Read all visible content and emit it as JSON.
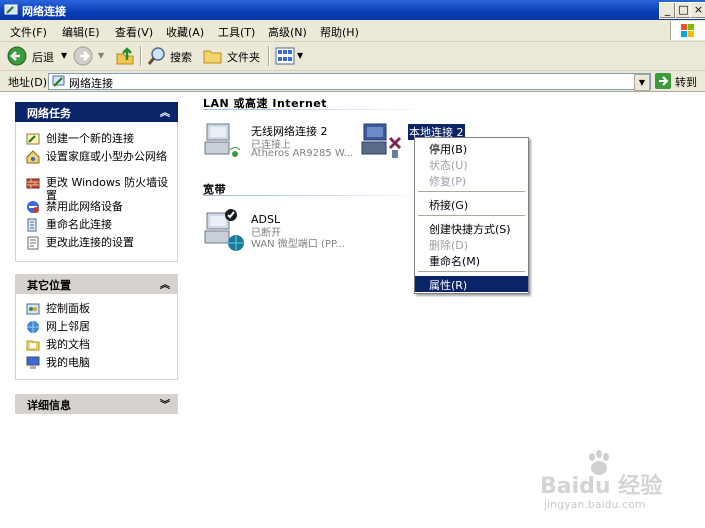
{
  "window": {
    "title": "网络连接",
    "controls": [
      "_",
      "□",
      "×"
    ]
  },
  "menubar": [
    "文件(F)",
    "编辑(E)",
    "查看(V)",
    "收藏(A)",
    "工具(T)",
    "高级(N)",
    "帮助(H)"
  ],
  "toolbar": {
    "back": "后退",
    "search": "搜索",
    "folders": "文件夹"
  },
  "address": {
    "label": "地址(D)",
    "value": "网络连接",
    "go": "转到"
  },
  "tasks_panel": {
    "title": "网络任务",
    "items": [
      "创建一个新的连接",
      "设置家庭或小型办公网络",
      "更改 Windows 防火墙设置",
      "禁用此网络设备",
      "重命名此连接",
      "更改此连接的设置"
    ]
  },
  "places_panel": {
    "title": "其它位置",
    "items": [
      "控制面板",
      "网上邻居",
      "我的文档",
      "我的电脑"
    ]
  },
  "details_panel": {
    "title": "详细信息"
  },
  "groups": {
    "lan": {
      "title": "LAN 或高速 Internet",
      "connections": [
        {
          "name": "无线网络连接 2",
          "status": "已连接上",
          "device": "Atheros AR9285 W..."
        },
        {
          "name": "本地连接 2"
        }
      ]
    },
    "broadband": {
      "title": "宽带",
      "connections": [
        {
          "name": "ADSL",
          "status": "已断开",
          "device": "WAN 微型端口 (PP..."
        }
      ]
    }
  },
  "context_menu": {
    "items": [
      {
        "label": "停用(B)"
      },
      {
        "label": "状态(U)",
        "disabled": true
      },
      {
        "label": "修复(P)",
        "disabled": true
      },
      {
        "label": "桥接(G)"
      },
      {
        "label": "创建快捷方式(S)"
      },
      {
        "label": "删除(D)",
        "disabled": true
      },
      {
        "label": "重命名(M)"
      },
      {
        "label": "属性(R)",
        "selected": true
      }
    ]
  },
  "watermark": {
    "brand": "Baidu 经验",
    "url": "jingyan.baidu.com"
  }
}
